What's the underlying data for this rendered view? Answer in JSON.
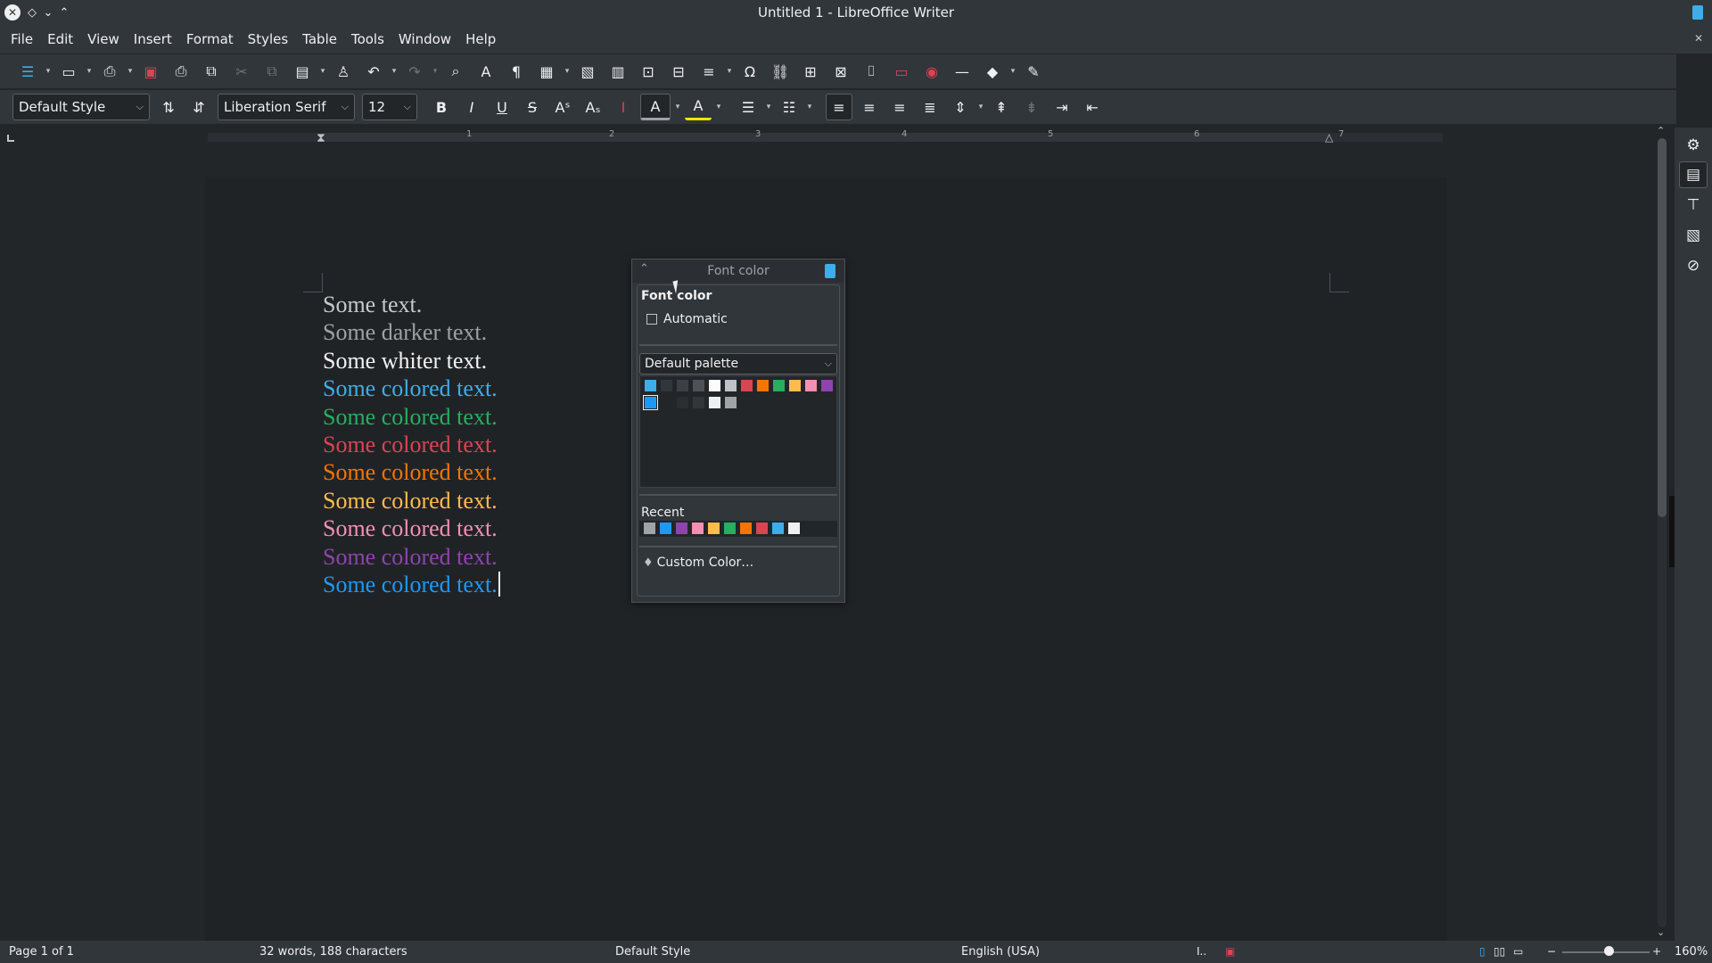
{
  "window": {
    "title": "Untitled 1 - LibreOffice Writer"
  },
  "menu": [
    "File",
    "Edit",
    "View",
    "Insert",
    "Format",
    "Styles",
    "Table",
    "Tools",
    "Window",
    "Help"
  ],
  "formatting": {
    "paragraph_style": "Default Style",
    "font_name": "Liberation Serif",
    "font_size": "12"
  },
  "document": {
    "paragraphs": [
      {
        "text": "Some text.",
        "color": "#c8c8c8"
      },
      {
        "text": "Some darker text.",
        "color": "#a0a0a0"
      },
      {
        "text": "Some whiter text.",
        "color": "#f2f2f2"
      },
      {
        "text": "Some colored text.",
        "color": "#3daee9"
      },
      {
        "text": "Some colored text.",
        "color": "#27ae60"
      },
      {
        "text": "Some colored text.",
        "color": "#da4453"
      },
      {
        "text": "Some colored text.",
        "color": "#f67400"
      },
      {
        "text": "Some colored text.",
        "color": "#fdbc4b"
      },
      {
        "text": "Some colored text.",
        "color": "#f48fb1"
      },
      {
        "text": "Some colored text.",
        "color": "#8e44ad"
      },
      {
        "text": "Some colored text.",
        "color": "#1d99f3"
      }
    ]
  },
  "ruler": {
    "numbers": [
      "1",
      "2",
      "3",
      "4",
      "5",
      "6",
      "7"
    ]
  },
  "font_color_popup": {
    "header_title": "Font color",
    "section_title": "Font color",
    "automatic_label": "Automatic",
    "palette_name": "Default palette",
    "swatches_row1": [
      "#3daee9",
      "#31363b",
      "#3b4045",
      "#4d5257",
      "#fcfcfc",
      "#bdc3c7",
      "#da4453",
      "#f67400",
      "#27ae60",
      "#fdbc4b",
      "#f48fb1",
      "#8e44ad"
    ],
    "swatches_row2": [
      "#1d99f3",
      "#232629",
      "#2a2e32",
      "#31363b",
      "#eff0f1",
      "#a0a4a8"
    ],
    "recent_label": "Recent",
    "recent_swatches": [
      "#a0a4a8",
      "#1d99f3",
      "#8e44ad",
      "#f48fb1",
      "#fdbc4b",
      "#27ae60",
      "#f67400",
      "#da4453",
      "#3daee9",
      "#eff0f1"
    ],
    "custom_color_label": "Custom Color…"
  },
  "statusbar": {
    "page": "Page 1 of 1",
    "words": "32 words, 188 characters",
    "page_style": "Default Style",
    "language": "English (USA)",
    "zoom": "160%"
  },
  "colors": {
    "accent": "#3daee9",
    "background": "#232629",
    "chrome": "#31363b",
    "highlight": "#f7e300"
  }
}
